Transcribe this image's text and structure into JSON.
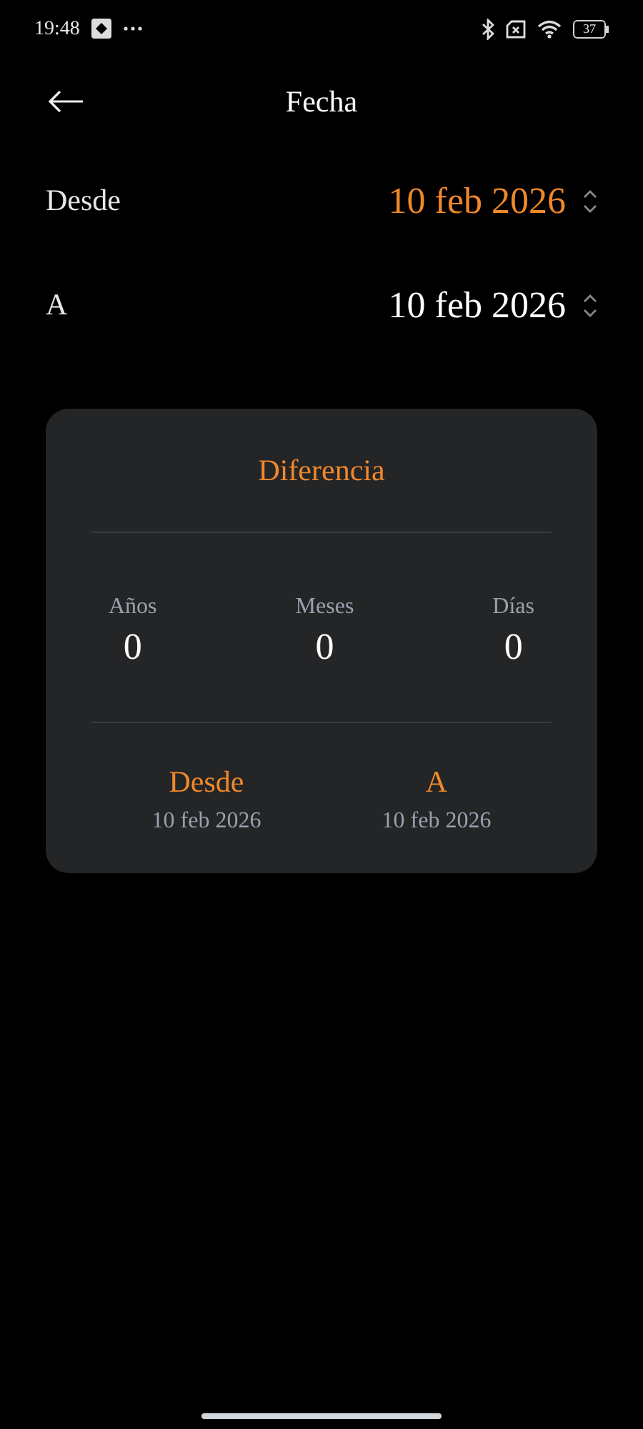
{
  "status_bar": {
    "time": "19:48",
    "battery": "37"
  },
  "header": {
    "title": "Fecha"
  },
  "date_rows": [
    {
      "label": "Desde",
      "value": "10 feb 2026",
      "selected": true
    },
    {
      "label": "A",
      "value": "10 feb 2026",
      "selected": false
    }
  ],
  "difference_card": {
    "title": "Diferencia",
    "stats": [
      {
        "label": "Años",
        "value": "0"
      },
      {
        "label": "Meses",
        "value": "0"
      },
      {
        "label": "Días",
        "value": "0"
      }
    ],
    "range": [
      {
        "label": "Desde",
        "value": "10 feb 2026"
      },
      {
        "label": "A",
        "value": "10 feb 2026"
      }
    ]
  }
}
